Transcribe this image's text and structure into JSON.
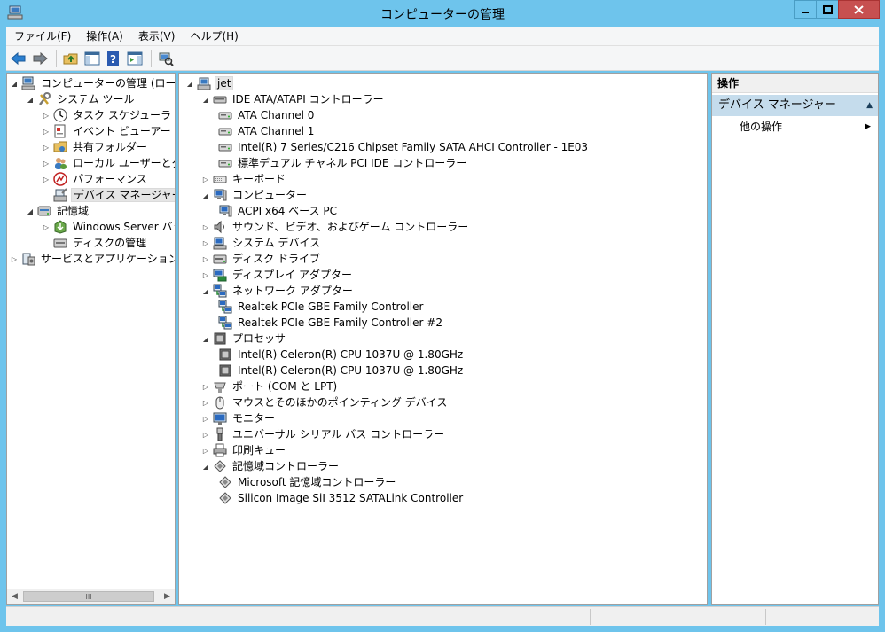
{
  "window": {
    "title": "コンピューターの管理",
    "controls": [
      "minimize",
      "maximize",
      "close"
    ]
  },
  "menu": [
    "ファイル(F)",
    "操作(A)",
    "表示(V)",
    "ヘルプ(H)"
  ],
  "toolbar": {
    "icons": [
      "back-arrow",
      "forward-arrow",
      "up-folder",
      "show-hide-console-tree",
      "help",
      "show-hide-action-pane",
      "scan-hardware"
    ]
  },
  "tree": {
    "items": [
      {
        "label": "コンピューターの管理 (ローカル)",
        "expander": "open",
        "icon": "computer-management-icon"
      },
      {
        "label": "システム ツール",
        "expander": "open",
        "icon": "system-tools-icon"
      },
      {
        "label": "タスク スケジューラ",
        "expander": "closed",
        "icon": "clock-icon"
      },
      {
        "label": "イベント ビューアー",
        "expander": "closed",
        "icon": "event-viewer-icon"
      },
      {
        "label": "共有フォルダー",
        "expander": "closed",
        "icon": "shared-folder-icon"
      },
      {
        "label": "ローカル ユーザーとグループ",
        "expander": "closed",
        "icon": "users-icon"
      },
      {
        "label": "パフォーマンス",
        "expander": "closed",
        "icon": "performance-icon"
      },
      {
        "label": "デバイス マネージャー",
        "expander": "none",
        "icon": "device-manager-icon",
        "selected": true
      },
      {
        "label": "記憶域",
        "expander": "open",
        "icon": "storage-icon"
      },
      {
        "label": "Windows Server バックアップ",
        "expander": "closed",
        "icon": "backup-icon"
      },
      {
        "label": "ディスクの管理",
        "expander": "none",
        "icon": "disk-management-icon"
      },
      {
        "label": "サービスとアプリケーション",
        "expander": "closed",
        "icon": "services-icon"
      }
    ],
    "scroll_thumb_glyph": "III"
  },
  "devices": {
    "root": "jet",
    "items": [
      {
        "label": "IDE ATA/ATAPI コントローラー",
        "expander": "open",
        "icon": "ide-controller-icon"
      },
      {
        "label": "ATA Channel 0",
        "expander": "none",
        "icon": "ide-channel-icon"
      },
      {
        "label": "ATA Channel 1",
        "expander": "none",
        "icon": "ide-channel-icon"
      },
      {
        "label": "Intel(R) 7 Series/C216 Chipset Family SATA AHCI Controller - 1E03",
        "expander": "none",
        "icon": "ide-channel-icon"
      },
      {
        "label": "標準デュアル チャネル PCI IDE コントローラー",
        "expander": "none",
        "icon": "ide-channel-icon"
      },
      {
        "label": "キーボード",
        "expander": "closed",
        "icon": "keyboard-icon"
      },
      {
        "label": "コンピューター",
        "expander": "open",
        "icon": "computer-icon"
      },
      {
        "label": "ACPI x64 ベース PC",
        "expander": "none",
        "icon": "computer-icon"
      },
      {
        "label": "サウンド、ビデオ、およびゲーム コントローラー",
        "expander": "closed",
        "icon": "speaker-icon"
      },
      {
        "label": "システム デバイス",
        "expander": "closed",
        "icon": "system-device-icon"
      },
      {
        "label": "ディスク ドライブ",
        "expander": "closed",
        "icon": "disk-drive-icon"
      },
      {
        "label": "ディスプレイ アダプター",
        "expander": "closed",
        "icon": "display-adapter-icon"
      },
      {
        "label": "ネットワーク アダプター",
        "expander": "open",
        "icon": "network-adapter-icon"
      },
      {
        "label": "Realtek PCIe GBE Family Controller",
        "expander": "none",
        "icon": "network-adapter-icon"
      },
      {
        "label": "Realtek PCIe GBE Family Controller #2",
        "expander": "none",
        "icon": "network-adapter-icon"
      },
      {
        "label": "プロセッサ",
        "expander": "open",
        "icon": "processor-icon"
      },
      {
        "label": "Intel(R) Celeron(R) CPU 1037U @ 1.80GHz",
        "expander": "none",
        "icon": "processor-icon"
      },
      {
        "label": "Intel(R) Celeron(R) CPU 1037U @ 1.80GHz",
        "expander": "none",
        "icon": "processor-icon"
      },
      {
        "label": "ポート (COM と LPT)",
        "expander": "closed",
        "icon": "port-icon"
      },
      {
        "label": "マウスとそのほかのポインティング デバイス",
        "expander": "closed",
        "icon": "mouse-icon"
      },
      {
        "label": "モニター",
        "expander": "closed",
        "icon": "monitor-icon"
      },
      {
        "label": "ユニバーサル シリアル バス コントローラー",
        "expander": "closed",
        "icon": "usb-icon"
      },
      {
        "label": "印刷キュー",
        "expander": "closed",
        "icon": "printer-icon"
      },
      {
        "label": "記憶域コントローラー",
        "expander": "open",
        "icon": "storage-controller-icon"
      },
      {
        "label": "Microsoft 記憶域コントローラー",
        "expander": "none",
        "icon": "storage-controller-icon"
      },
      {
        "label": "Silicon Image SiI 3512 SATALink Controller",
        "expander": "none",
        "icon": "storage-controller-icon"
      }
    ]
  },
  "actions": {
    "header": "操作",
    "section": "デバイス マネージャー",
    "item": "他の操作"
  },
  "colors": {
    "titlebar": "#6ec4ec",
    "close_button": "#c75050",
    "action_section": "#c5dcec"
  }
}
